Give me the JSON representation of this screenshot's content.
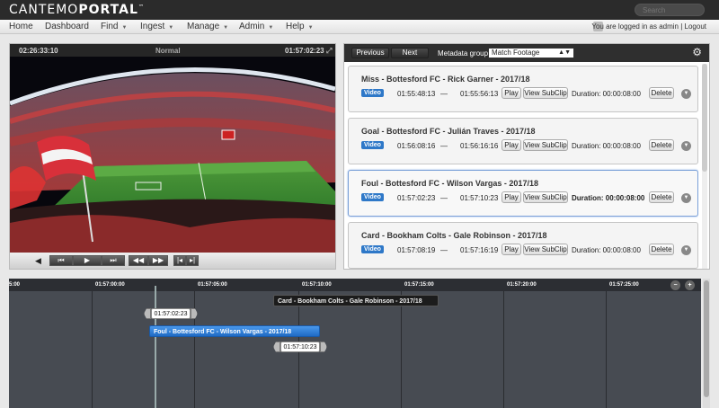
{
  "app": {
    "brand_light": "CANTEMO",
    "brand_bold": "PORTAL",
    "brand_tm": "™"
  },
  "search": {
    "placeholder": "Search"
  },
  "nav": [
    {
      "label": "Home"
    },
    {
      "label": "Dashboard"
    },
    {
      "label": "Find",
      "dropdown": true
    },
    {
      "label": "Ingest",
      "dropdown": true
    },
    {
      "label": "Manage",
      "dropdown": true
    },
    {
      "label": "Admin",
      "dropdown": true
    },
    {
      "label": "Help",
      "dropdown": true
    }
  ],
  "user": {
    "text": "You are logged in as admin | Logout"
  },
  "player": {
    "timecode_left": "02:26:33:10",
    "mode": "Normal",
    "timecode_right": "01:57:02:23",
    "controls": [
      "volume-icon",
      "skip-back",
      "play",
      "skip-forward",
      "frame-back",
      "frame-forward",
      "mark-in",
      "mark-out"
    ]
  },
  "metadata": {
    "prev_label": "Previous",
    "next_label": "Next",
    "group_label": "Metadata group:",
    "group_value": "Match Footage",
    "segments": [
      {
        "title": "Miss - Bottesford FC - Rick Garner - 2017/18",
        "badge": "Video",
        "in": "01:55:48:13",
        "dash": "—",
        "out": "01:55:56:13",
        "play": "Play",
        "view": "View SubClip",
        "duration": "Duration: 00:00:08:00",
        "delete": "Delete",
        "selected": false
      },
      {
        "title": "Goal - Bottesford FC - Julián Traves - 2017/18",
        "badge": "Video",
        "in": "01:56:08:16",
        "dash": "—",
        "out": "01:56:16:16",
        "play": "Play",
        "view": "View SubClip",
        "duration": "Duration: 00:00:08:00",
        "delete": "Delete",
        "selected": false
      },
      {
        "title": "Foul - Bottesford FC - Wilson Vargas - 2017/18",
        "badge": "Video",
        "in": "01:57:02:23",
        "dash": "—",
        "out": "01:57:10:23",
        "play": "Play",
        "view": "View SubClip",
        "duration": "Duration: 00:00:08:00",
        "delete": "Delete",
        "selected": true
      },
      {
        "title": "Card - Bookham Colts - Gale Robinson - 2017/18",
        "badge": "Video",
        "in": "01:57:08:19",
        "dash": "—",
        "out": "01:57:16:19",
        "play": "Play",
        "view": "View SubClip",
        "duration": "Duration: 00:00:08:00",
        "delete": "Delete",
        "selected": false
      }
    ]
  },
  "timeline": {
    "ticks": [
      "5:00",
      "01:57:00:00",
      "01:57:05:00",
      "01:57:10:00",
      "01:57:15:00",
      "01:57:20:00",
      "01:57:25:00"
    ],
    "clips": [
      {
        "label": "Card - Bookham Colts - Gale Robinson - 2017/18",
        "color": "#1c1c1c"
      },
      {
        "label": "Foul - Bottesford FC - Wilson Vargas - 2017/18",
        "color": "#2f7fd8"
      }
    ],
    "in_marker": "01:57:02:23",
    "out_marker": "01:57:10:23"
  },
  "colors": {
    "accent": "#2e78c8",
    "dark_header": "#2b2b2b"
  }
}
